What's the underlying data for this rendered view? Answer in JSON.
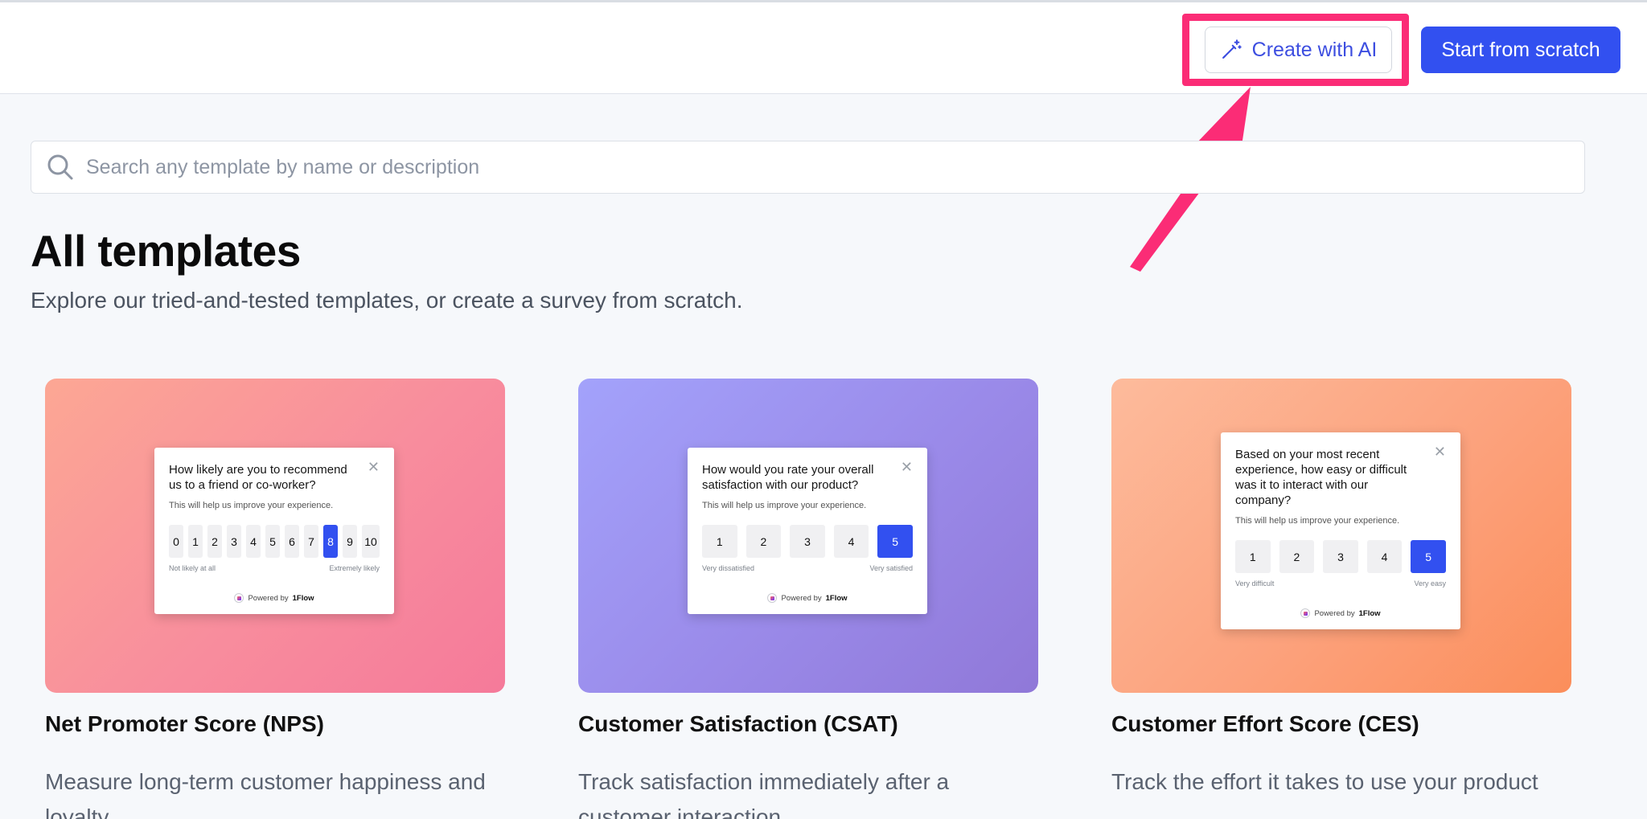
{
  "header": {
    "ai_button_label": "Create with AI",
    "scratch_button_label": "Start from scratch"
  },
  "search": {
    "placeholder": "Search any template by name or description"
  },
  "page": {
    "title": "All templates",
    "subtitle": "Explore our tried-and-tested templates, or create a survey from scratch."
  },
  "colors": {
    "primary": "#3250f0",
    "highlight": "#fb2c76"
  },
  "templates": [
    {
      "name": "Net Promoter Score (NPS)",
      "description": "Measure long-term customer happiness and loyalty",
      "preview": {
        "question": "How likely are you to recommend us to a friend or co-worker?",
        "hint": "This will help us improve your experience.",
        "scale": [
          "0",
          "1",
          "2",
          "3",
          "4",
          "5",
          "6",
          "7",
          "8",
          "9",
          "10"
        ],
        "selected": "8",
        "low_label": "Not likely at all",
        "high_label": "Extremely likely",
        "powered_prefix": "Powered by",
        "powered_brand": "1Flow"
      }
    },
    {
      "name": "Customer Satisfaction (CSAT)",
      "description": "Track satisfaction immediately after a customer interaction",
      "preview": {
        "question": "How would you rate your overall satisfaction with our product?",
        "hint": "This will help us improve your experience.",
        "scale": [
          "1",
          "2",
          "3",
          "4",
          "5"
        ],
        "selected": "5",
        "low_label": "Very dissatisfied",
        "high_label": "Very satisfied",
        "powered_prefix": "Powered by",
        "powered_brand": "1Flow"
      }
    },
    {
      "name": "Customer Effort Score (CES)",
      "description": "Track the effort it takes to use your product",
      "preview": {
        "question": "Based on your most recent experience, how easy or difficult was it to interact with our company?",
        "hint": "This will help us improve your experience.",
        "scale": [
          "1",
          "2",
          "3",
          "4",
          "5"
        ],
        "selected": "5",
        "low_label": "Very difficult",
        "high_label": "Very easy",
        "powered_prefix": "Powered by",
        "powered_brand": "1Flow"
      }
    }
  ]
}
